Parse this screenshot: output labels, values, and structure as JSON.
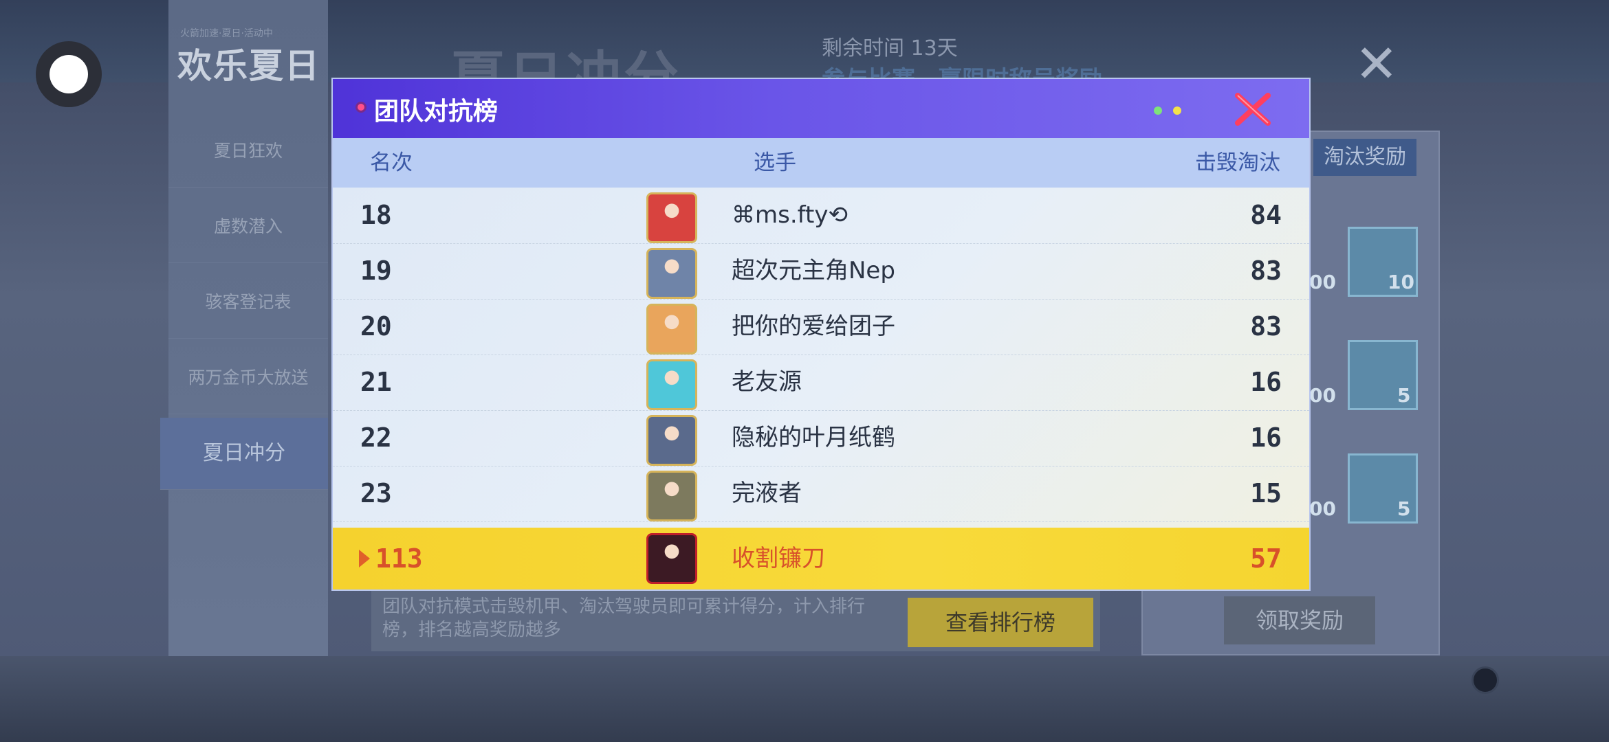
{
  "background": {
    "logo": "欢乐夏日",
    "logo_sub": "火箭加速·夏日·活动中",
    "sidebar": [
      "夏日狂欢",
      "虚数潜入",
      "骇客登记表",
      "两万金币大放送",
      "夏日冲分"
    ],
    "active_sidebar": "夏日冲分",
    "big_title": "夏日冲分",
    "remaining": "剩余时间 13天",
    "subtitle": "参与比赛，赢限时称号奖励",
    "elim_reward": "淘汰奖励",
    "gift_counts": [
      "00",
      "10",
      "00",
      "5",
      "00",
      "5"
    ],
    "description": "团队对抗模式击毁机甲、淘汰驾驶员即可累计得分，计入排行榜，排名越高奖励越多",
    "view_rank": "查看排行榜",
    "claim": "领取奖励"
  },
  "modal": {
    "title": "团队对抗榜",
    "columns": {
      "rank": "名次",
      "player": "选手",
      "score": "击毁淘汰"
    },
    "rows": [
      {
        "rank": "18",
        "name": "⌘ms.fty⟲",
        "score": "84",
        "avatar_color": "#d8433f"
      },
      {
        "rank": "19",
        "name": "超次元主角Nep",
        "score": "83",
        "avatar_color": "#6f84a8"
      },
      {
        "rank": "20",
        "name": "把你的爱给团子",
        "score": "83",
        "avatar_color": "#e9a55c"
      },
      {
        "rank": "21",
        "name": "老友源",
        "score": "16",
        "avatar_color": "#4fc7d9"
      },
      {
        "rank": "22",
        "name": "隐秘的叶月纸鹤",
        "score": "16",
        "avatar_color": "#5a6a8c"
      },
      {
        "rank": "23",
        "name": "完液者",
        "score": "15",
        "avatar_color": "#7d7a5e"
      }
    ],
    "self": {
      "rank": "113",
      "name": "收割镰刀",
      "score": "57",
      "avatar_color": "#3c1a24"
    }
  },
  "colors": {
    "header": "#4f33d8",
    "highlight": "#f5d22e",
    "close": "#ff3f5e"
  }
}
